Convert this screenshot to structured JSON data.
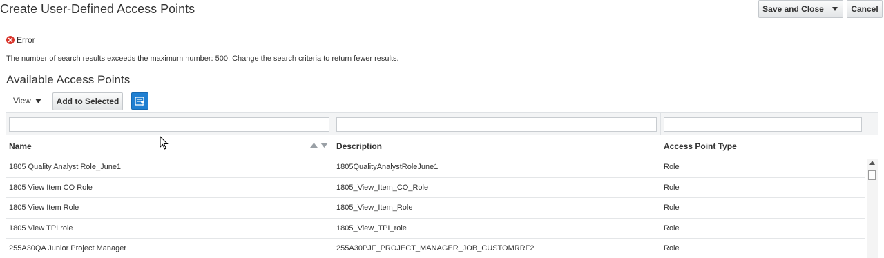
{
  "header": {
    "title": "Create User-Defined Access Points",
    "save_close_label": "Save and Close",
    "cancel_label": "Cancel"
  },
  "error": {
    "title": "Error",
    "message": "The number of search results exceeds the maximum number: 500. Change the search criteria to return fewer results.",
    "color": "#d9342b"
  },
  "section": {
    "title": "Available Access Points",
    "view_label": "View",
    "add_label": "Add to Selected"
  },
  "table": {
    "columns": [
      "Name",
      "Description",
      "Access Point Type"
    ],
    "rows": [
      {
        "name": "1805 Quality Analyst Role_June1",
        "description": "1805QualityAnalystRoleJune1",
        "type": "Role"
      },
      {
        "name": "1805 View Item CO Role",
        "description": "1805_View_Item_CO_Role",
        "type": "Role"
      },
      {
        "name": "1805 View Item Role",
        "description": "1805_View_Item_Role",
        "type": "Role"
      },
      {
        "name": "1805 View TPI role",
        "description": "1805_View_TPI_role",
        "type": "Role"
      },
      {
        "name": "255A30QA Junior Project Manager",
        "description": "255A30PJF_PROJECT_MANAGER_JOB_CUSTOMRRF2",
        "type": "Role"
      }
    ]
  },
  "colors": {
    "accent": "#1f7fd1",
    "error": "#d9342b"
  },
  "icons": {
    "error": "error-circle-icon",
    "filter": "query-by-example-icon",
    "dropdown": "caret-down-icon",
    "sort": "sort-arrows-icon"
  }
}
